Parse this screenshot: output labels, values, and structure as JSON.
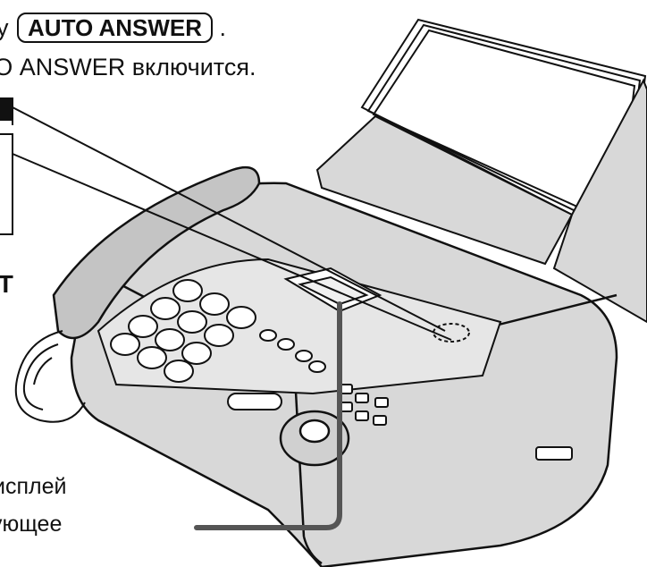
{
  "instruction": {
    "line1_prefix": "у",
    "key_label": "AUTO ANSWER",
    "line1_suffix": ".",
    "line2": "ТО ANSWER включится."
  },
  "callout_label_fragment": "IT",
  "display_caption": {
    "line1": "исплей",
    "line2": "ующее"
  },
  "colors": {
    "line": "#111111",
    "device_fill": "#d8d8d8",
    "shadow": "#bdbdbd",
    "pointer": "#555555"
  }
}
